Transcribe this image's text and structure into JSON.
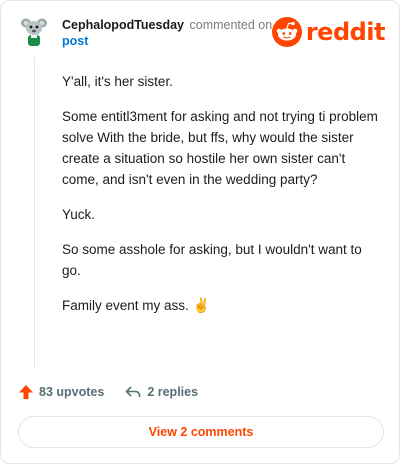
{
  "comment": {
    "username": "CephalopodTuesday",
    "action": "commented on",
    "target": "post",
    "brand": "reddit",
    "paragraphs": [
      "Y'all, it's her sister.",
      "Some entitl3ment for asking and not trying ti problem solve With the bride, but ffs, why would the sister create a situation so hostile her own sister can't come, and isn't even in the wedding party?",
      "Yuck.",
      "So some asshole for asking, but I wouldn't want to go.",
      "Family event my ass."
    ],
    "emoji": "✌️",
    "upvotes": "83 upvotes",
    "replies": "2 replies",
    "view_comments": "View 2 comments"
  },
  "colors": {
    "brand": "#ff4500",
    "link": "#0079d3",
    "muted": "#576f76"
  },
  "icons": [
    "snoo-avatar-icon",
    "reddit-alien-icon",
    "upvote-arrow-icon",
    "reply-arrow-icon"
  ]
}
